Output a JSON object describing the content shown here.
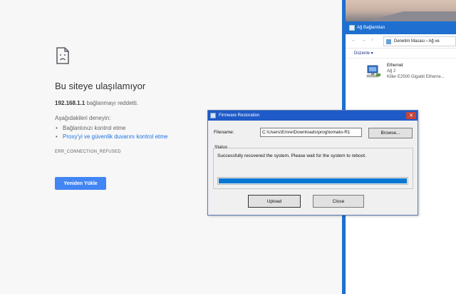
{
  "browser": {
    "error_title": "Bu siteye ulaşılamıyor",
    "host": "192.168.1.1",
    "host_suffix": " bağlanmayı reddetti.",
    "try_heading": "Aşağıdakileri deneyin:",
    "suggestions": [
      "Bağlantınızı kontrol etme",
      "Proxy'yi ve güvenlik duvarını kontrol etme"
    ],
    "error_code": "ERR_CONNECTION_REFUSED",
    "reload_label": "Yeniden Yükle"
  },
  "network_window": {
    "title": "Ağ Bağlantıları",
    "address": "Denetim Masası  ›  Ağ ve",
    "command": "Düzenle ▾",
    "adapter": {
      "name": "Ethernet",
      "network": "Ağ 2",
      "device": "Killer E2500 Gigabit Etherne..."
    }
  },
  "dialog": {
    "title": "Firmware Restoration",
    "close_glyph": "✕",
    "filename_label": "Filename:",
    "filename_value": "C:\\Users\\Emre\\Downloads\\prog\\tomato-R1",
    "browse_label": "Browse...",
    "status_label": "Status",
    "status_message": "Successfully recovered the system. Please wait for the system to reboot.",
    "progress": 1.0,
    "upload_label": "Upload",
    "close_label": "Close"
  },
  "colors": {
    "link_blue": "#1a73e8",
    "button_blue": "#4285f4",
    "title_blue": "#1e5ac8",
    "progress_blue": "#0878d4"
  },
  "icons": [
    "sad-page-icon",
    "app-icon",
    "back-icon",
    "forward-icon",
    "network-adapter-icon",
    "close-icon"
  ]
}
